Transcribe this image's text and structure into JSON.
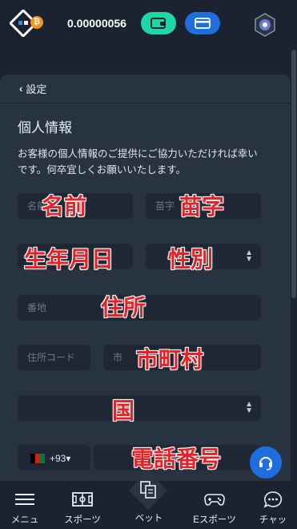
{
  "header": {
    "balance": "0.00000056",
    "btc_symbol": "₿",
    "colors": {
      "wallet": "#1fd6a8",
      "card": "#1f6ee0",
      "btc": "#f7931a"
    }
  },
  "panel": {
    "back_label": "設定",
    "section_title": "個人情報",
    "description": "お客様の個人情報のご提供にご協力いただければ幸いです。何卒宜しくお願いいたします。"
  },
  "form": {
    "first_name_placeholder": "名前",
    "last_name_placeholder": "苗字",
    "address_placeholder": "番地",
    "postal_placeholder": "住所コード",
    "city_placeholder": "市",
    "phone_code": "+93"
  },
  "annotations": {
    "name": "名前",
    "surname": "苗字",
    "birthdate": "生年月日",
    "gender": "性別",
    "address": "住所",
    "city": "市町村",
    "country": "国",
    "phone": "電話番号"
  },
  "nav": {
    "menu": "メニュ",
    "sports": "スポーツ",
    "bet": "ベット",
    "esports": "Eスポーツ",
    "chat": "チャッ"
  }
}
